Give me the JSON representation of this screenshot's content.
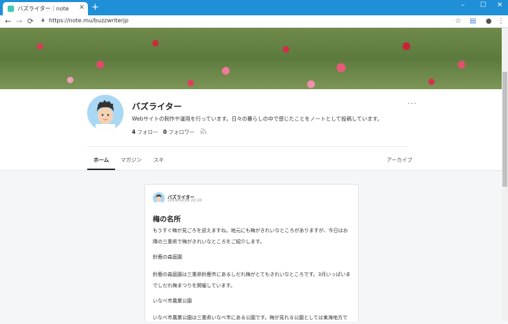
{
  "browser": {
    "tab_title": "バズライター｜note",
    "tab_close": "×",
    "new_tab": "+",
    "url": "https://note.mu/buzzwriterjp",
    "window_controls": {
      "minimize": "–",
      "maximize": "☐",
      "close": "✕"
    },
    "nav": {
      "back": "←",
      "forward": "→",
      "reload": "⟳"
    },
    "toolbar_icons": {
      "bookmark": "☆",
      "extension": "▤",
      "account": "●",
      "menu": "⋮"
    }
  },
  "profile": {
    "name": "バズライター",
    "description": "Webサイトの制作や運用を行っています。日々の暮らしの中で感じたことをノートとして投稿しています。",
    "follow_count": "4",
    "follow_label": "フォロー",
    "follower_count": "0",
    "follower_label": "フォロワー",
    "separator": "·",
    "more": "···"
  },
  "nav_tabs": {
    "home": "ホーム",
    "magazine": "マガジン",
    "likes": "スキ",
    "archive": "アーカイブ"
  },
  "article": {
    "author": "バズライター",
    "date": "2019/02/28 22:10",
    "title": "梅の名所",
    "paragraphs": [
      "もうすぐ梅が見ごろを迎えますね。地元にも梅がきれいなところがありますが、今日はお隣の三重県で梅がきれいなところをご紹介します。",
      "鈴鹿の森庭園",
      "鈴鹿の森庭園は三重県鈴鹿市にあるしだれ梅がとてもきれいなところです。3月いっぱいまでしだれ梅まつりを開催しています。",
      "いなべ市農業公園",
      "いなべ市農業公園は三重県いなべ市にある公園です。梅が見れる公園としては東海地方で"
    ]
  },
  "colors": {
    "titlebar": "#1f8fd8",
    "avatar_bg": "#a9d8f5",
    "favicon": "#41c9b4"
  }
}
